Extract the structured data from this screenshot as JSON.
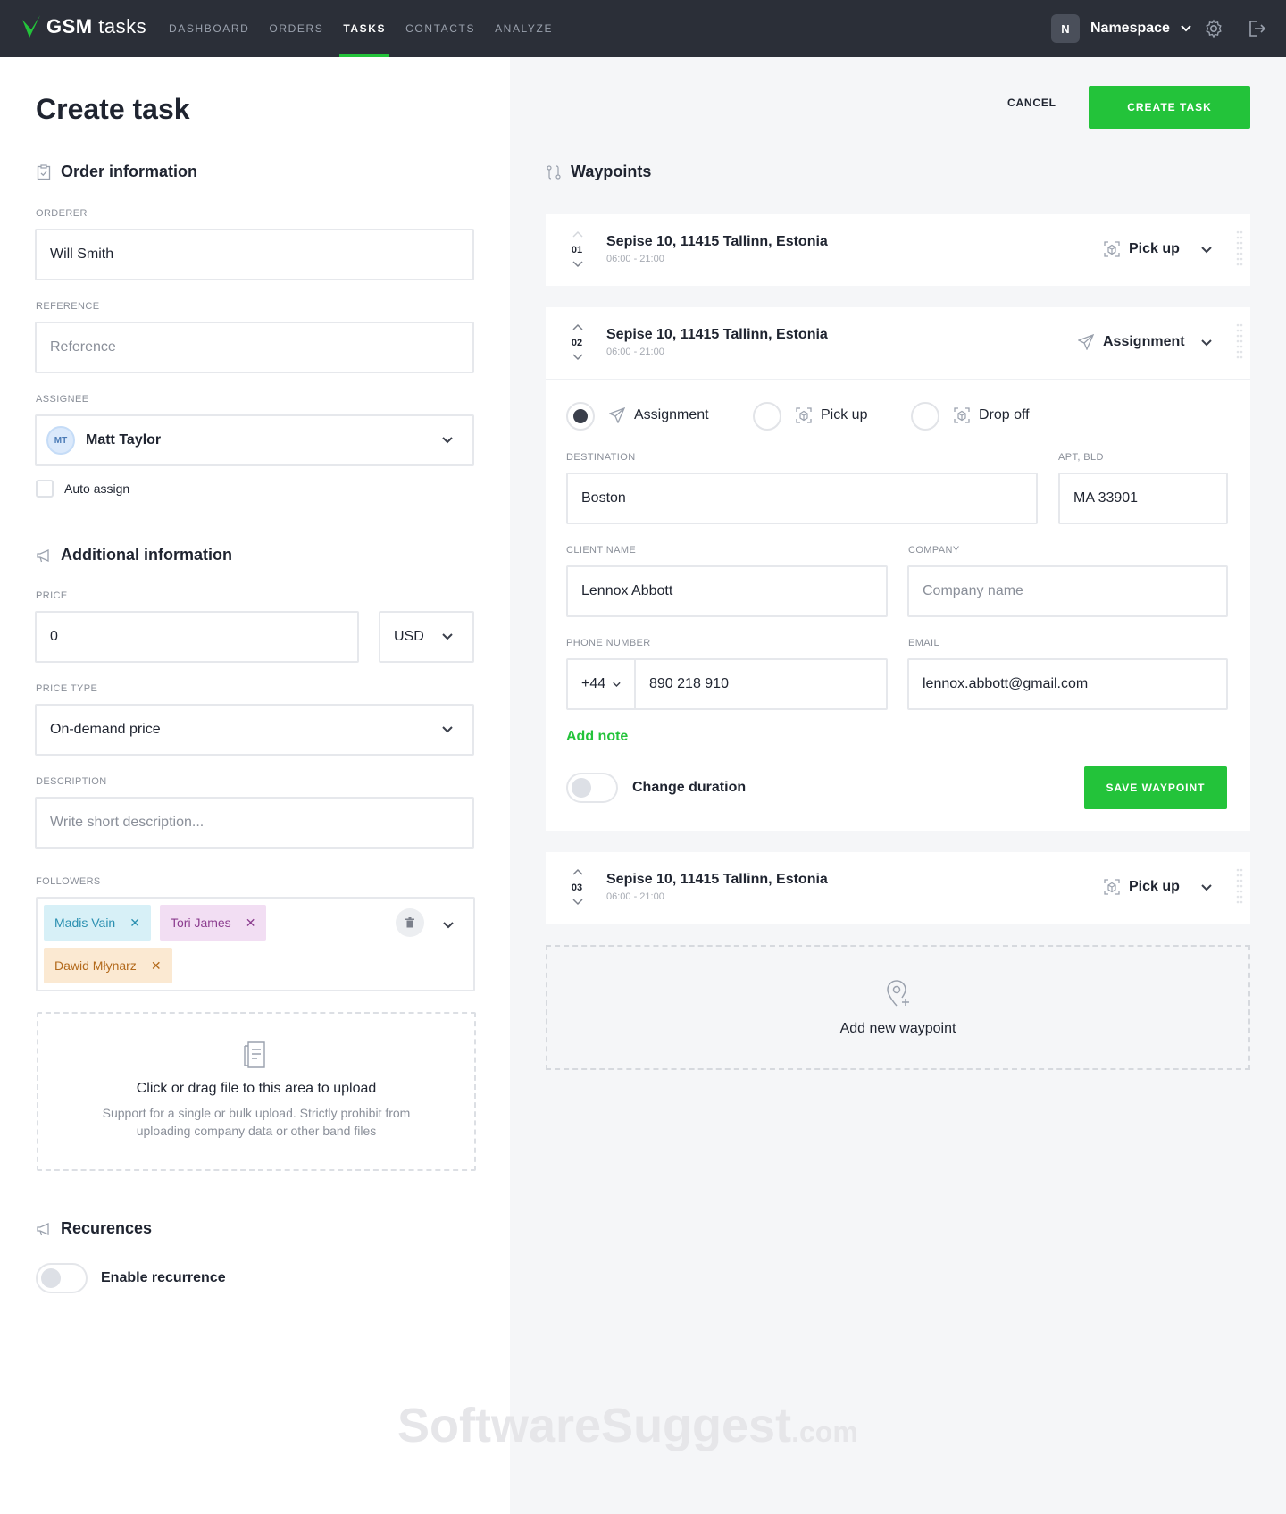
{
  "app": {
    "brand_bold": "GSM",
    "brand_light": "tasks"
  },
  "nav": [
    {
      "label": "DASHBOARD"
    },
    {
      "label": "ORDERS"
    },
    {
      "label": "TASKS",
      "active": true
    },
    {
      "label": "CONTACTS"
    },
    {
      "label": "ANALYZE"
    }
  ],
  "namespace": {
    "badge": "N",
    "label": "Namespace"
  },
  "page": {
    "title": "Create task",
    "cancel": "CANCEL",
    "create": "CREATE TASK"
  },
  "order": {
    "heading": "Order information",
    "orderer": {
      "label": "ORDERER",
      "value": "Will Smith"
    },
    "reference": {
      "label": "REFERENCE",
      "placeholder": "Reference"
    },
    "assignee": {
      "label": "ASSIGNEE",
      "initials": "MT",
      "value": "Matt Taylor"
    },
    "auto_assign": "Auto assign"
  },
  "additional": {
    "heading": "Additional information",
    "price": {
      "label": "PRICE",
      "value": "0",
      "currency": "USD"
    },
    "price_type": {
      "label": "PRICE TYPE",
      "value": "On-demand price"
    },
    "description": {
      "label": "DESCRIPTION",
      "placeholder": "Write short description..."
    },
    "followers": {
      "label": "FOLLOWERS",
      "tags": [
        {
          "name": "Madis Vain",
          "color": "#d7f0f7",
          "text": "#2a8fb0"
        },
        {
          "name": "Tori James",
          "color": "#f2def3",
          "text": "#8c3d8f"
        },
        {
          "name": "Dawid Młynarz",
          "color": "#fbe9d2",
          "text": "#b36a1c"
        }
      ]
    },
    "upload": {
      "title": "Click or drag file to this area to upload",
      "sub1": "Support for a single or bulk upload. Strictly prohibit from",
      "sub2": "uploading company data or other band files"
    }
  },
  "recurrences": {
    "heading": "Recurences",
    "toggle_label": "Enable recurrence"
  },
  "waypoints": {
    "heading": "Waypoints",
    "items": [
      {
        "num": "01",
        "address": "Sepise 10, 11415 Tallinn, Estonia",
        "time": "06:00 - 21:00",
        "type": "Pick up"
      },
      {
        "num": "02",
        "address": "Sepise 10, 11415 Tallinn, Estonia",
        "time": "06:00 - 21:00",
        "type": "Assignment"
      },
      {
        "num": "03",
        "address": "Sepise 10, 11415 Tallinn, Estonia",
        "time": "06:00 - 21:00",
        "type": "Pick up"
      }
    ],
    "edit": {
      "types": [
        "Assignment",
        "Pick up",
        "Drop off"
      ],
      "selected_type": "Assignment",
      "destination": {
        "label": "DESTINATION",
        "value": "Boston"
      },
      "apt": {
        "label": "APT, BLD",
        "value": "MA 33901"
      },
      "client": {
        "label": "CLIENT NAME",
        "value": "Lennox Abbott"
      },
      "company": {
        "label": "COMPANY",
        "placeholder": "Company name"
      },
      "phone": {
        "label": "PHONE NUMBER",
        "code": "+44",
        "value": "890 218 910"
      },
      "email": {
        "label": "EMAIL",
        "value": "lennox.abbott@gmail.com"
      },
      "add_note": "Add note",
      "change_duration": "Change duration",
      "save": "SAVE WAYPOINT"
    },
    "add_new": "Add new waypoint"
  },
  "watermark": {
    "main": "SoftwareSuggest",
    "suffix": ".com"
  },
  "colors": {
    "accent": "#23c33a",
    "topbar": "#2b2f38",
    "right_bg": "#f5f6f8"
  }
}
